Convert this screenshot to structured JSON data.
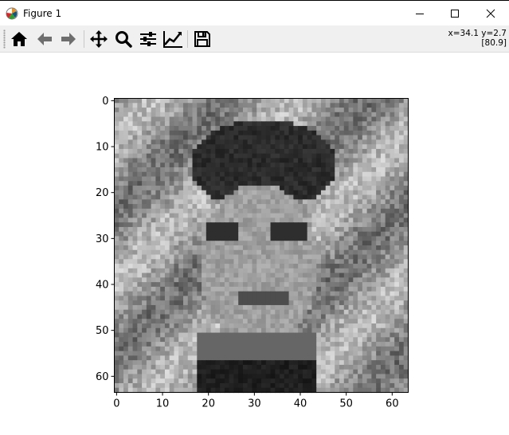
{
  "window": {
    "title": "Figure 1"
  },
  "toolbar": {
    "buttons": [
      {
        "name": "home-button",
        "icon": "home-icon"
      },
      {
        "name": "back-button",
        "icon": "arrow-left-icon"
      },
      {
        "name": "forward-button",
        "icon": "arrow-right-icon"
      },
      {
        "name": "pan-button",
        "icon": "move-icon"
      },
      {
        "name": "zoom-button",
        "icon": "magnifier-icon"
      },
      {
        "name": "subplots-button",
        "icon": "sliders-icon"
      },
      {
        "name": "edit-axes-button",
        "icon": "line-chart-icon"
      },
      {
        "name": "save-button",
        "icon": "floppy-disk-icon"
      }
    ],
    "coords_line1": "x=34.1 y=2.7",
    "coords_line2": "[80.9]"
  },
  "chart_data": {
    "type": "heatmap",
    "description_image": "grayscale 64x64 image",
    "colormap": "gray",
    "x_ticks": [
      "0",
      "10",
      "20",
      "30",
      "40",
      "50",
      "60"
    ],
    "y_ticks": [
      "0",
      "10",
      "20",
      "30",
      "40",
      "50",
      "60"
    ],
    "xlim": [
      -0.5,
      63.5
    ],
    "ylim": [
      63.5,
      -0.5
    ]
  }
}
